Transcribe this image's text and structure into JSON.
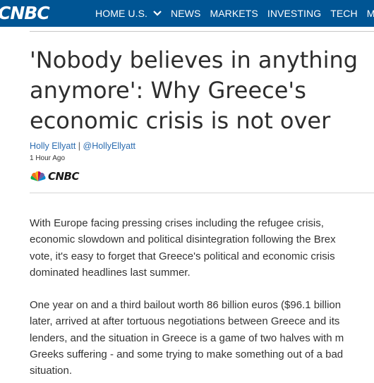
{
  "header": {
    "logo_text": "CNBC",
    "nav": [
      {
        "label": "HOME U.S.",
        "has_dropdown": true
      },
      {
        "label": "NEWS"
      },
      {
        "label": "MARKETS"
      },
      {
        "label": "INVESTING"
      },
      {
        "label": "TECH"
      },
      {
        "label": "MAK"
      }
    ],
    "bg_color": "#005594"
  },
  "article": {
    "headline_lines": [
      "'Nobody believes in anything",
      "anymore': Why Greece's",
      "economic crisis is not over"
    ],
    "author": "Holly Ellyatt",
    "separator": "|",
    "twitter": "@HollyEllyatt",
    "time": "1 Hour Ago",
    "source_logo": "CNBC",
    "paragraphs": [
      [
        "With Europe facing pressing crises including the refugee crisis,",
        "economic slowdown and political disintegration following the Brex",
        "vote, it's easy to forget that Greece's political and economic crisis",
        "dominated headlines last summer."
      ],
      [
        "One year on and a third bailout worth 86 billion euros ($96.1 billion",
        "later, arrived at after tortuous negotiations between Greece and its",
        "lenders, and the situation in Greece is a game of two halves with m",
        "Greeks suffering - and some trying to make something out of a bad",
        "situation."
      ]
    ],
    "link_color": "#2b6cb0"
  }
}
